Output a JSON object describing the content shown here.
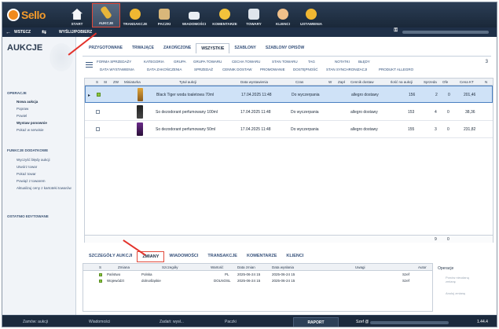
{
  "toolbar": {
    "items": [
      {
        "label": "START",
        "icon": "home-icon"
      },
      {
        "label": "AUKCJE",
        "icon": "hammer-icon"
      },
      {
        "label": "TRANSAKCJE",
        "icon": "coin-icon"
      },
      {
        "label": "PACZKI",
        "icon": "box-icon"
      },
      {
        "label": "WIADOMOŚCI",
        "icon": "mail-icon"
      },
      {
        "label": "KOMENTARZE",
        "icon": "comment-icon"
      },
      {
        "label": "TOWARY",
        "icon": "goods-icon"
      },
      {
        "label": "KLIENCI",
        "icon": "client-icon"
      },
      {
        "label": "USTAWIENIA",
        "icon": "gear-icon"
      }
    ]
  },
  "nav": {
    "back": "WSTECZ",
    "forward": "WYŚLIJ/POBIERZ"
  },
  "left": {
    "title": "AUKCJE",
    "ops_header": "OPERACJE",
    "ops": [
      "Nowa aukcja",
      "Popraw",
      "Powiel",
      "Wystaw ponownie",
      "Pokaż w serwisie"
    ],
    "fn_header": "FUNKCJE DODATKOWE",
    "fns": [
      "Wyczyść błędy aukcji",
      "Utwórz towar",
      "Pokaż towar",
      "Powiąż z towarem",
      "Aktualizuj ceny z kartoteki towarów"
    ],
    "recent_header": "OSTATNIO EDYTOWANE"
  },
  "tabs": [
    "PRZYGOTOWANE",
    "TRWAJĄCE",
    "ZAKOŃCZONE",
    "WSZYSTKIE",
    "SZABLONY",
    "SZABLONY OPISÓW"
  ],
  "filters_row1": [
    "FORMA SPRZEDAŻY",
    "KATEGORIA",
    "GRUPA",
    "GRUPA TOWARU",
    "CECHA TOWARU",
    "STAN TOWARU",
    "TAG",
    "NOTATKI",
    "BŁĘDY"
  ],
  "filters_row2": [
    "DATA WYSTAWIENIA",
    "DATA ZAKOŃCZENIA",
    "SPRZEDAŻ",
    "CENNIK DOSTAW",
    "PROMOWANIE",
    "DOSTĘPNOŚĆ",
    "STAN SYNCHRONIZACJI",
    "PRODUKT ALLEGRO"
  ],
  "count": "3",
  "columns": [
    "S",
    "SI",
    "ZW",
    "Miniaturka",
    "Tytuł aukcji",
    "Data wystawienia",
    "Czas",
    "W",
    "Zapł",
    "Cennik dostaw",
    "Ilość na aukcji",
    "Sprzeda",
    "Ofe",
    "Cena KT",
    "N"
  ],
  "rows": [
    {
      "title": "Black Tiger woda toaletowa 70ml",
      "date": "17.04.2025 11:48",
      "czas": "Do wyczerpania",
      "cennik": "allegro dostawy",
      "ilosc": "156",
      "sprz": "2",
      "ofe": "0",
      "cena": "201,46"
    },
    {
      "title": "So dezodorant perfumowany 100ml",
      "date": "17.04.2025 11:48",
      "czas": "Do wyczerpania",
      "cennik": "allegro dostawy",
      "ilosc": "153",
      "sprz": "4",
      "ofe": "0",
      "cena": "38,36"
    },
    {
      "title": "So dezodorant perfumowany 50ml",
      "date": "17.04.2025 11:48",
      "czas": "Do wyczerpania",
      "cennik": "allegro dostawy",
      "ilosc": "155",
      "sprz": "3",
      "ofe": "0",
      "cena": "231,82"
    }
  ],
  "totals": {
    "sprz": "9",
    "ofe": "0"
  },
  "bottom_tabs": [
    "SZCZEGÓŁY AUKCJI",
    "ZMIANY",
    "WIADOMOŚCI",
    "TRANSAKCJE",
    "KOMENTARZE",
    "KLIENCI"
  ],
  "changes": {
    "columns": [
      "S",
      "Zmiana",
      "Szczegóły",
      "Wartość",
      "Data zmian",
      "Data wysłania",
      "Uwagi",
      "Autor"
    ],
    "rows": [
      {
        "zmiana": "Państwo",
        "szczegoly": "Polska",
        "wartosc": "PL",
        "data_zm": "2025-06-24 15",
        "data_wys": "2025-06-24 15",
        "autor": "Szef"
      },
      {
        "zmiana": "Województ",
        "szczegoly": "dolnośląskie",
        "wartosc": "DOLNOSL",
        "data_zm": "2025-06-24 15",
        "data_wys": "2025-06-24 15",
        "autor": "Szef"
      }
    ]
  },
  "operations": {
    "header": "Operacje",
    "items": [
      "Ponów nieudaną zmianę",
      "Anuluj zmianę"
    ]
  },
  "status": {
    "items": [
      "Zamów: aukcji",
      "Wiadomości",
      "Zadań: wysł...",
      "Paczki"
    ],
    "raport": "RAPORT",
    "user": "Szef @",
    "version": "1.44.4"
  }
}
